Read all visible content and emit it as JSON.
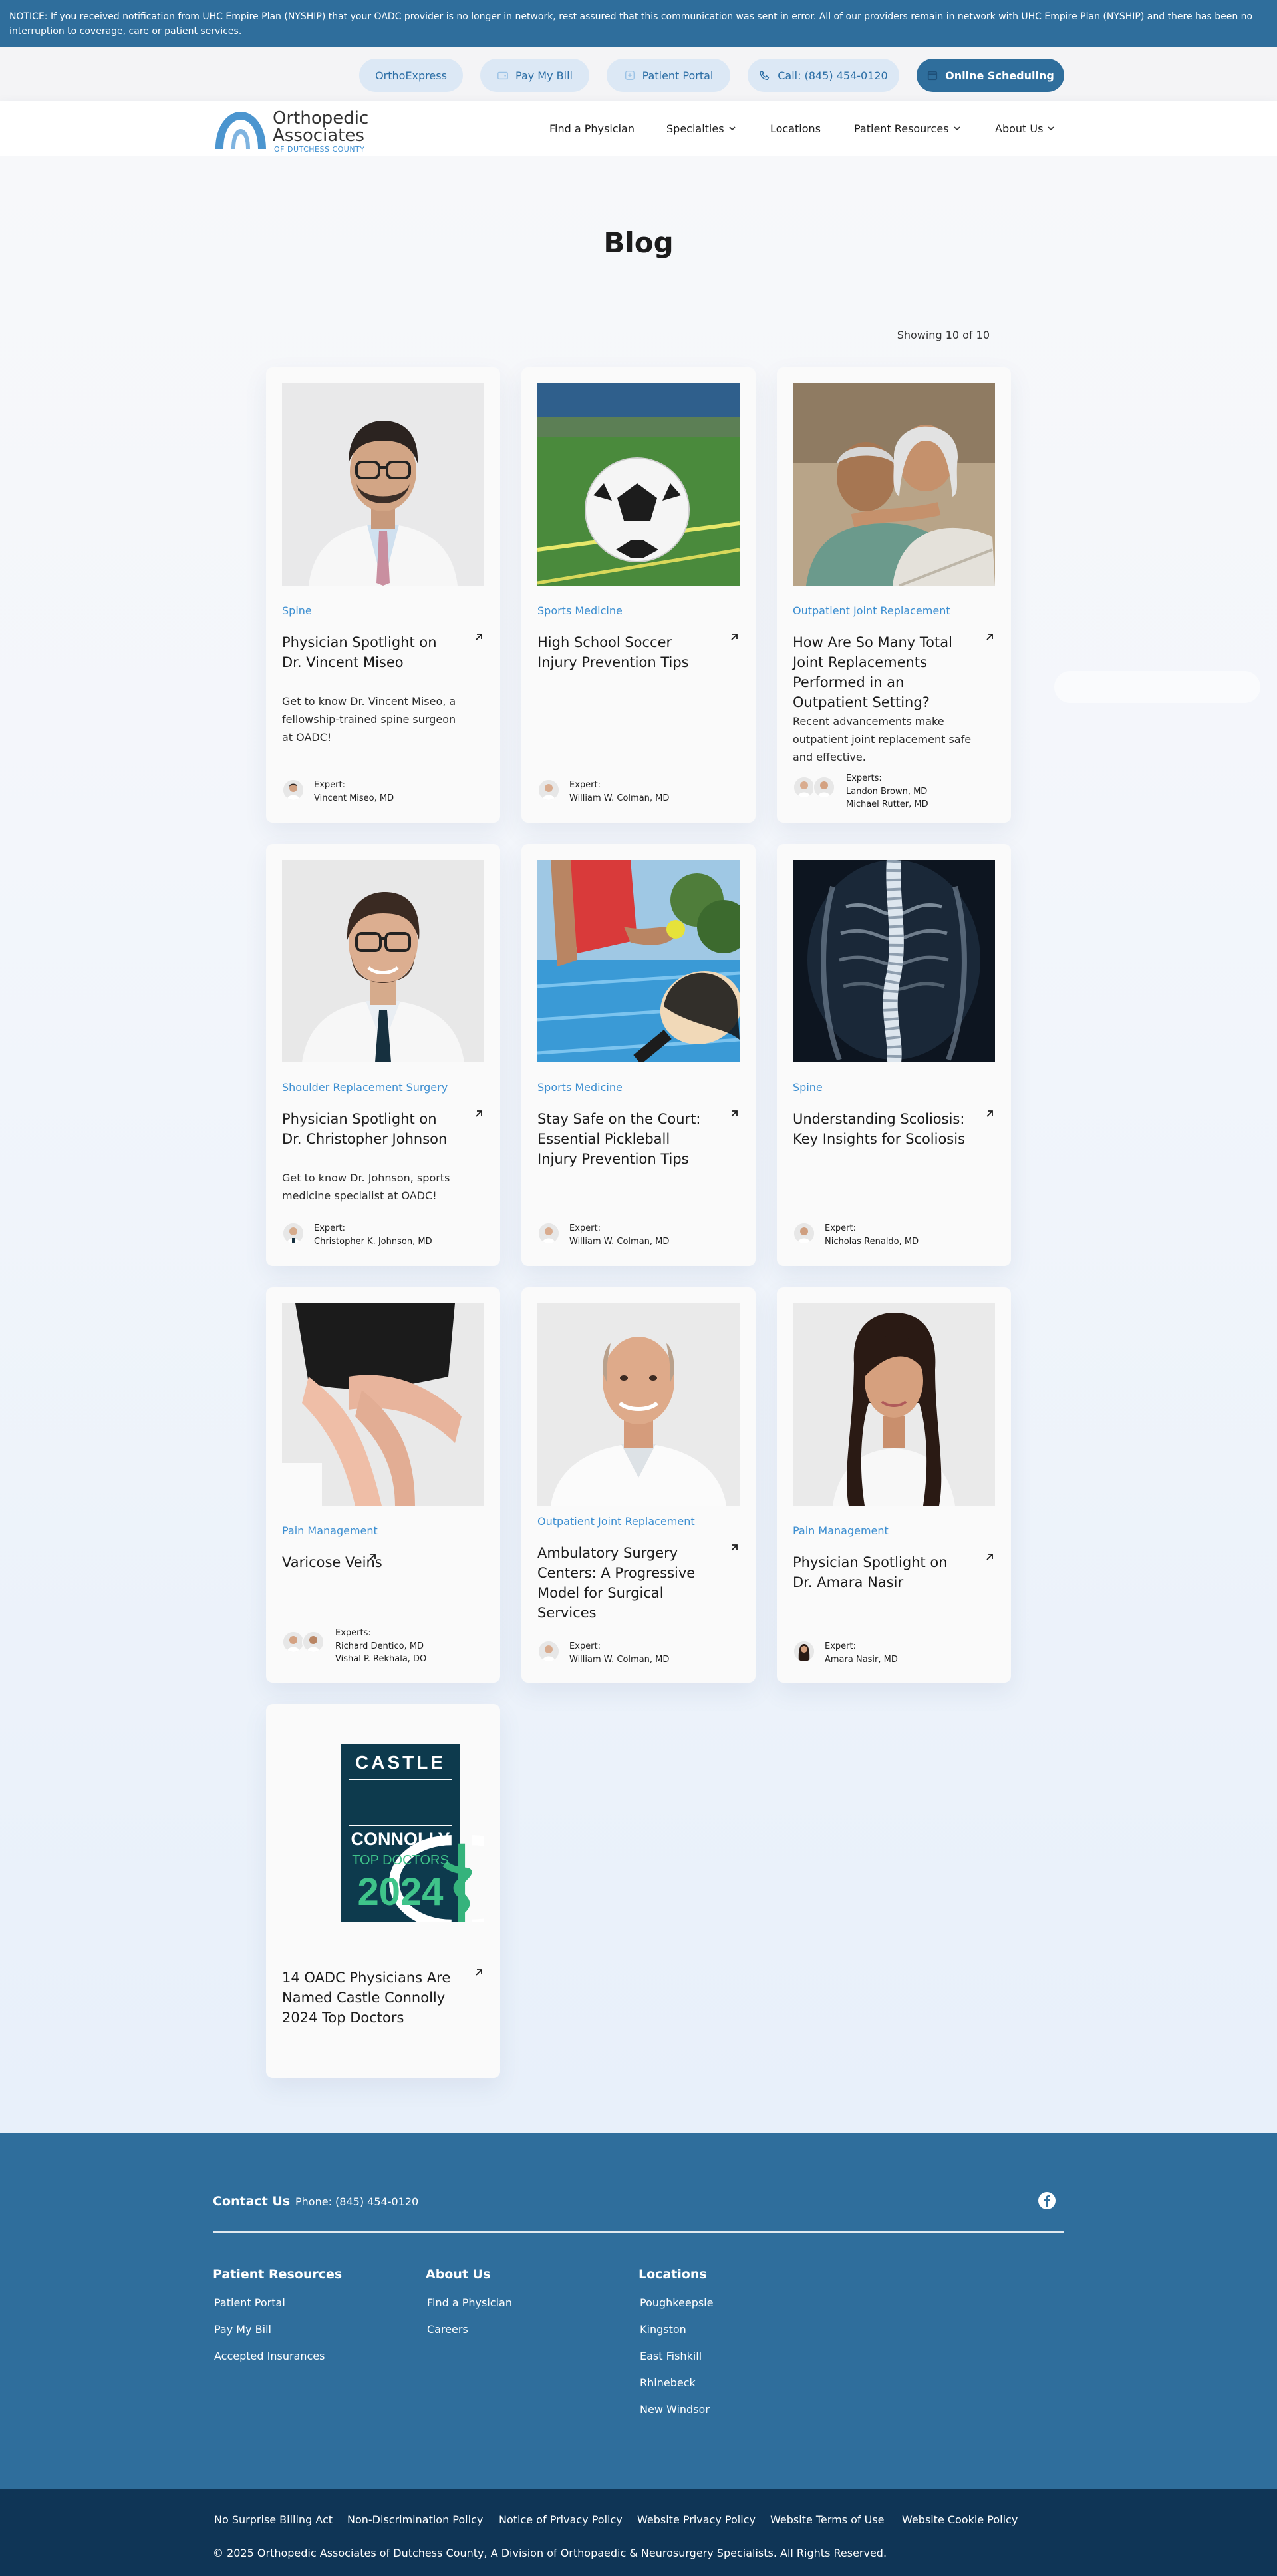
{
  "notice": "NOTICE: If you received notification from UHC Empire Plan (NYSHIP) that your OADC provider is no longer in network, rest assured that this communication was sent in error. All of our providers remain in network with UHC Empire Plan (NYSHIP) and there has been no interruption to coverage, care or patient services.",
  "utility_links": {
    "orthoexpress": "OrthoExpress",
    "pay_bill": "Pay My Bill",
    "portal": "Patient Portal",
    "call": "Call: (845) 454-0120",
    "scheduling": "Online Scheduling"
  },
  "logo": {
    "line1": "Orthopedic",
    "line2": "Associates",
    "line3": "OF DUTCHESS COUNTY"
  },
  "nav": {
    "find_physician": "Find a Physician",
    "specialties": "Specialties",
    "locations": "Locations",
    "patient_resources": "Patient Resources",
    "about_us": "About Us"
  },
  "page_title": "Blog",
  "showing": "Showing 10 of 10",
  "posts": [
    {
      "category": "Spine",
      "title": "Physician Spotlight on Dr. Vincent Miseo",
      "excerpt": "Get to know Dr. Vincent Miseo, a fellowship-trained spine surgeon at OADC!",
      "expert_label": "Expert:",
      "experts": [
        "Vincent Miseo, MD"
      ]
    },
    {
      "category": "Sports Medicine",
      "title": "High School Soccer Injury Prevention Tips",
      "excerpt": "",
      "expert_label": "Expert:",
      "experts": [
        "William W. Colman, MD"
      ]
    },
    {
      "category": "Outpatient Joint Replacement",
      "title": "How Are So Many Total Joint Replacements Performed in an Outpatient Setting?",
      "excerpt": "Recent advancements make outpatient joint replacement safe and effective.",
      "expert_label": "Experts:",
      "experts": [
        "Landon Brown, MD",
        "Michael Rutter, MD"
      ]
    },
    {
      "category": "Shoulder Replacement Surgery",
      "title": "Physician Spotlight on Dr. Christopher Johnson",
      "excerpt": "Get to know Dr. Johnson, sports medicine specialist at OADC!",
      "expert_label": "Expert:",
      "experts": [
        "Christopher K. Johnson, MD"
      ]
    },
    {
      "category": "Sports Medicine",
      "title": "Stay Safe on the Court: Essential Pickleball Injury Prevention Tips",
      "excerpt": "",
      "expert_label": "Expert:",
      "experts": [
        "William W. Colman, MD"
      ]
    },
    {
      "category": "Spine",
      "title": "Understanding Scoliosis: Key Insights for Scoliosis",
      "excerpt": "",
      "expert_label": "Expert:",
      "experts": [
        "Nicholas Renaldo, MD"
      ]
    },
    {
      "category": "Pain Management",
      "title": "Varicose Veins",
      "excerpt": "",
      "expert_label": "Experts:",
      "experts": [
        "Richard Dentico, MD",
        "Vishal P. Rekhala, DO"
      ]
    },
    {
      "category": "Outpatient Joint Replacement",
      "title": "Ambulatory Surgery Centers: A Progressive Model for Surgical Services",
      "excerpt": "",
      "expert_label": "Expert:",
      "experts": [
        "William W. Colman, MD"
      ]
    },
    {
      "category": "Pain Management",
      "title": "Physician Spotlight on Dr. Amara Nasir",
      "excerpt": "",
      "expert_label": "Expert:",
      "experts": [
        "Amara Nasir, MD"
      ]
    },
    {
      "category": "",
      "title": "14 OADC Physicians Are Named Castle Connolly 2024 Top Doctors",
      "excerpt": "",
      "expert_label": "",
      "experts": []
    }
  ],
  "castle_badge": {
    "line1": "CASTLE",
    "line2": "CONNOLLY",
    "line3": "TOP DOCTORS",
    "year": "2024"
  },
  "footer": {
    "contact_label": "Contact Us",
    "phone": "Phone: (845) 454-0120",
    "patient_resources": {
      "heading": "Patient Resources",
      "links": [
        "Patient Portal",
        "Pay My Bill",
        "Accepted Insurances"
      ]
    },
    "about_us": {
      "heading": "About Us",
      "links": [
        "Find a Physician",
        "Careers"
      ]
    },
    "locations": {
      "heading": "Locations",
      "links": [
        "Poughkeepsie",
        "Kingston",
        "East Fishkill",
        "Rhinebeck",
        "New Windsor"
      ]
    }
  },
  "legal": {
    "links": [
      "No Surprise Billing Act",
      "Non-Discrimination Policy",
      "Notice of Privacy Policy",
      "Website Privacy Policy",
      "Website Terms of Use",
      "Website Cookie Policy"
    ],
    "copyright": "© 2025 Orthopedic Associates of Dutchess County, A Division of Orthopaedic & Neurosurgery Specialists. All Rights Reserved."
  },
  "colors": {
    "brand_blue": "#2f6e9c",
    "accent_blue": "#3d8fd1",
    "footer_dark": "#0f3556"
  }
}
